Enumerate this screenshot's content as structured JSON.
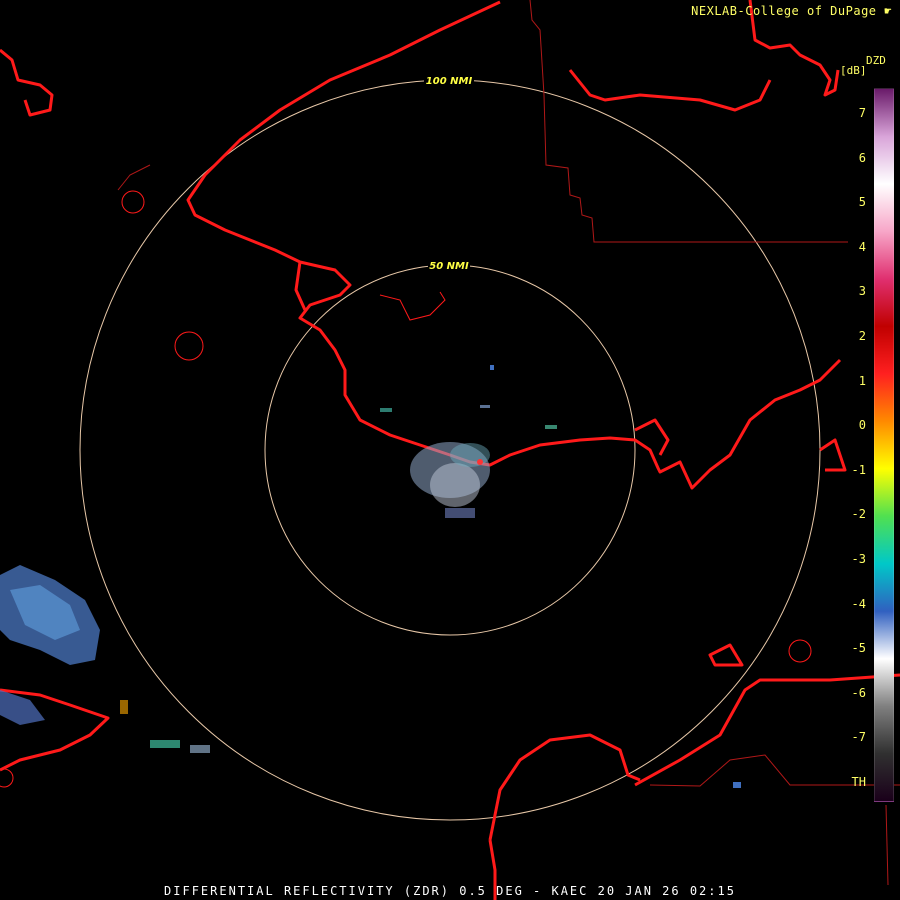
{
  "credit": "NEXLAB-College of DuPage",
  "title_bar": "DIFFERENTIAL REFLECTIVITY (ZDR) 0.5 DEG - KAEC 20 JAN 26 02:15",
  "colorbar": {
    "title": "DZD",
    "unit": "[dB]",
    "labels": [
      "7",
      "6",
      "5",
      "4",
      "3",
      "2",
      "1",
      "0",
      "-1",
      "-2",
      "-3",
      "-4",
      "-5",
      "-6",
      "-7",
      "TH"
    ],
    "stops": [
      "#6a1b6a",
      "#d9a4d9",
      "#ffffff",
      "#f7a6c8",
      "#e03070",
      "#c00000",
      "#ff2020",
      "#ff8a00",
      "#ffff00",
      "#50e050",
      "#00c8c8",
      "#3060c0",
      "#ffffff",
      "#808080",
      "#303030",
      "#1a001a"
    ]
  },
  "rings": [
    {
      "label": "50 NMI"
    },
    {
      "label": "100 NMI"
    }
  ]
}
